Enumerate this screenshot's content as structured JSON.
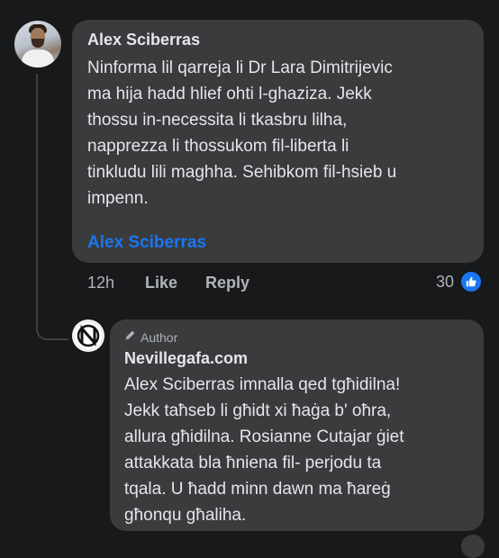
{
  "comment": {
    "author": "Alex Sciberras",
    "lines": [
      "Ninforma lil qarreja li Dr Lara Dimitrijevic",
      "ma hija hadd hlief ohti l-ghaziza. Jekk",
      "thossu in-necessita li tkasbru lilha,",
      "napprezza li thossukom fil-liberta li",
      "tinkludu lili maghha. Sehibkom fil-hsieb u",
      "impenn."
    ],
    "mention": "Alex Sciberras",
    "time": "12h",
    "like_label": "Like",
    "reply_label": "Reply",
    "reaction_count": "30"
  },
  "reply": {
    "badge": "Author",
    "author": "Nevillegafa.com",
    "lines": [
      "Alex Sciberras imnalla qed tgħidilna!",
      "Jekk taħseb li għidt xi ħaġa b' oħra,",
      "allura għidilna. Rosianne Cutajar ġiet",
      "attakkata bla ħniena fil- perjodu ta",
      "tqala. U ħadd minn dawn ma ħareġ",
      "għonqu għaliha."
    ]
  },
  "colors": {
    "background": "#18191a",
    "bubble": "#3a3b3c",
    "text": "#e4e6eb",
    "secondary": "#b0b3b8",
    "accent": "#1877f2"
  },
  "icons": [
    "thumbs-up-icon",
    "pencil-icon",
    "nevillegafa-logo-icon"
  ]
}
